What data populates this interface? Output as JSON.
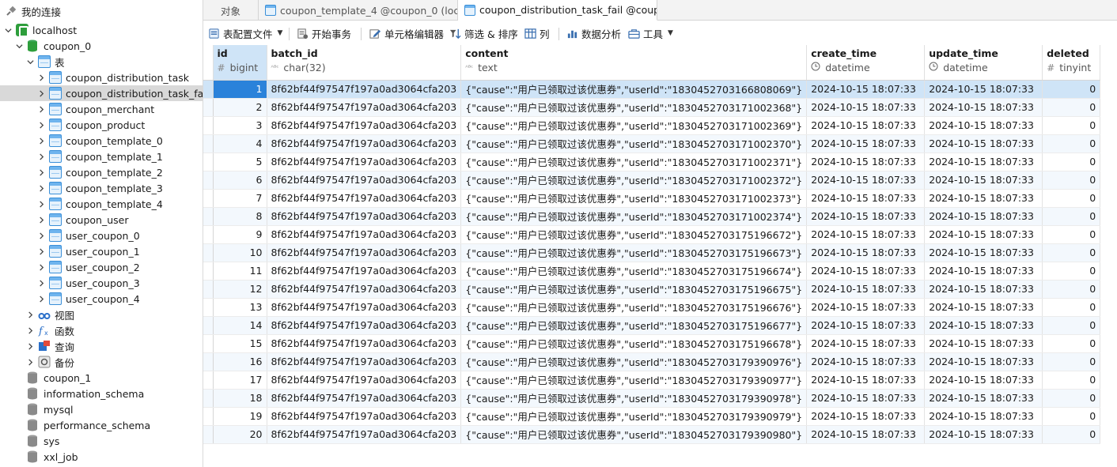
{
  "sidebar": {
    "root_label": "我的连接",
    "connection": "localhost",
    "database": "coupon_0",
    "tables_group": "表",
    "tables": [
      "coupon_distribution_task",
      "coupon_distribution_task_fail",
      "coupon_merchant",
      "coupon_product",
      "coupon_template_0",
      "coupon_template_1",
      "coupon_template_2",
      "coupon_template_3",
      "coupon_template_4",
      "coupon_user",
      "user_coupon_0",
      "user_coupon_1",
      "user_coupon_2",
      "user_coupon_3",
      "user_coupon_4"
    ],
    "selected_table": "coupon_distribution_task_fail",
    "groups": [
      "视图",
      "函数",
      "查询",
      "备份"
    ],
    "other_databases": [
      "coupon_1",
      "information_schema",
      "mysql",
      "performance_schema",
      "sys",
      "xxl_job"
    ]
  },
  "tabs": [
    {
      "label": "对象"
    },
    {
      "label": "coupon_template_4 @coupon_0 (loc..."
    },
    {
      "label": "coupon_distribution_task_fail @coup..."
    }
  ],
  "toolbar": {
    "table_config": "表配置文件",
    "begin_transaction": "开始事务",
    "cell_editor": "单元格编辑器",
    "filter_sort": "筛选 & 排序",
    "columns": "列",
    "data_analysis": "数据分析",
    "tools": "工具"
  },
  "grid": {
    "columns": [
      {
        "name": "id",
        "type": "bigint",
        "type_icon": "#"
      },
      {
        "name": "batch_id",
        "type": "char(32)",
        "type_icon": "ABC"
      },
      {
        "name": "content",
        "type": "text",
        "type_icon": "ABC"
      },
      {
        "name": "create_time",
        "type": "datetime",
        "type_icon": "clock"
      },
      {
        "name": "update_time",
        "type": "datetime",
        "type_icon": "clock"
      },
      {
        "name": "deleted",
        "type": "tinyint",
        "type_icon": "#"
      }
    ],
    "rows": [
      {
        "id": "1",
        "batch_id": "8f62bf44f97547f197a0ad3064cfa203",
        "content": "{\"cause\":\"用户已领取过该优惠券\",\"userId\":\"1830452703166808069\"}",
        "create_time": "2024-10-15 18:07:33",
        "update_time": "2024-10-15 18:07:33",
        "deleted": "0"
      },
      {
        "id": "2",
        "batch_id": "8f62bf44f97547f197a0ad3064cfa203",
        "content": "{\"cause\":\"用户已领取过该优惠券\",\"userId\":\"1830452703171002368\"}",
        "create_time": "2024-10-15 18:07:33",
        "update_time": "2024-10-15 18:07:33",
        "deleted": "0"
      },
      {
        "id": "3",
        "batch_id": "8f62bf44f97547f197a0ad3064cfa203",
        "content": "{\"cause\":\"用户已领取过该优惠券\",\"userId\":\"1830452703171002369\"}",
        "create_time": "2024-10-15 18:07:33",
        "update_time": "2024-10-15 18:07:33",
        "deleted": "0"
      },
      {
        "id": "4",
        "batch_id": "8f62bf44f97547f197a0ad3064cfa203",
        "content": "{\"cause\":\"用户已领取过该优惠券\",\"userId\":\"1830452703171002370\"}",
        "create_time": "2024-10-15 18:07:33",
        "update_time": "2024-10-15 18:07:33",
        "deleted": "0"
      },
      {
        "id": "5",
        "batch_id": "8f62bf44f97547f197a0ad3064cfa203",
        "content": "{\"cause\":\"用户已领取过该优惠券\",\"userId\":\"1830452703171002371\"}",
        "create_time": "2024-10-15 18:07:33",
        "update_time": "2024-10-15 18:07:33",
        "deleted": "0"
      },
      {
        "id": "6",
        "batch_id": "8f62bf44f97547f197a0ad3064cfa203",
        "content": "{\"cause\":\"用户已领取过该优惠券\",\"userId\":\"1830452703171002372\"}",
        "create_time": "2024-10-15 18:07:33",
        "update_time": "2024-10-15 18:07:33",
        "deleted": "0"
      },
      {
        "id": "7",
        "batch_id": "8f62bf44f97547f197a0ad3064cfa203",
        "content": "{\"cause\":\"用户已领取过该优惠券\",\"userId\":\"1830452703171002373\"}",
        "create_time": "2024-10-15 18:07:33",
        "update_time": "2024-10-15 18:07:33",
        "deleted": "0"
      },
      {
        "id": "8",
        "batch_id": "8f62bf44f97547f197a0ad3064cfa203",
        "content": "{\"cause\":\"用户已领取过该优惠券\",\"userId\":\"1830452703171002374\"}",
        "create_time": "2024-10-15 18:07:33",
        "update_time": "2024-10-15 18:07:33",
        "deleted": "0"
      },
      {
        "id": "9",
        "batch_id": "8f62bf44f97547f197a0ad3064cfa203",
        "content": "{\"cause\":\"用户已领取过该优惠券\",\"userId\":\"1830452703175196672\"}",
        "create_time": "2024-10-15 18:07:33",
        "update_time": "2024-10-15 18:07:33",
        "deleted": "0"
      },
      {
        "id": "10",
        "batch_id": "8f62bf44f97547f197a0ad3064cfa203",
        "content": "{\"cause\":\"用户已领取过该优惠券\",\"userId\":\"1830452703175196673\"}",
        "create_time": "2024-10-15 18:07:33",
        "update_time": "2024-10-15 18:07:33",
        "deleted": "0"
      },
      {
        "id": "11",
        "batch_id": "8f62bf44f97547f197a0ad3064cfa203",
        "content": "{\"cause\":\"用户已领取过该优惠券\",\"userId\":\"1830452703175196674\"}",
        "create_time": "2024-10-15 18:07:33",
        "update_time": "2024-10-15 18:07:33",
        "deleted": "0"
      },
      {
        "id": "12",
        "batch_id": "8f62bf44f97547f197a0ad3064cfa203",
        "content": "{\"cause\":\"用户已领取过该优惠券\",\"userId\":\"1830452703175196675\"}",
        "create_time": "2024-10-15 18:07:33",
        "update_time": "2024-10-15 18:07:33",
        "deleted": "0"
      },
      {
        "id": "13",
        "batch_id": "8f62bf44f97547f197a0ad3064cfa203",
        "content": "{\"cause\":\"用户已领取过该优惠券\",\"userId\":\"1830452703175196676\"}",
        "create_time": "2024-10-15 18:07:33",
        "update_time": "2024-10-15 18:07:33",
        "deleted": "0"
      },
      {
        "id": "14",
        "batch_id": "8f62bf44f97547f197a0ad3064cfa203",
        "content": "{\"cause\":\"用户已领取过该优惠券\",\"userId\":\"1830452703175196677\"}",
        "create_time": "2024-10-15 18:07:33",
        "update_time": "2024-10-15 18:07:33",
        "deleted": "0"
      },
      {
        "id": "15",
        "batch_id": "8f62bf44f97547f197a0ad3064cfa203",
        "content": "{\"cause\":\"用户已领取过该优惠券\",\"userId\":\"1830452703175196678\"}",
        "create_time": "2024-10-15 18:07:33",
        "update_time": "2024-10-15 18:07:33",
        "deleted": "0"
      },
      {
        "id": "16",
        "batch_id": "8f62bf44f97547f197a0ad3064cfa203",
        "content": "{\"cause\":\"用户已领取过该优惠券\",\"userId\":\"1830452703179390976\"}",
        "create_time": "2024-10-15 18:07:33",
        "update_time": "2024-10-15 18:07:33",
        "deleted": "0"
      },
      {
        "id": "17",
        "batch_id": "8f62bf44f97547f197a0ad3064cfa203",
        "content": "{\"cause\":\"用户已领取过该优惠券\",\"userId\":\"1830452703179390977\"}",
        "create_time": "2024-10-15 18:07:33",
        "update_time": "2024-10-15 18:07:33",
        "deleted": "0"
      },
      {
        "id": "18",
        "batch_id": "8f62bf44f97547f197a0ad3064cfa203",
        "content": "{\"cause\":\"用户已领取过该优惠券\",\"userId\":\"1830452703179390978\"}",
        "create_time": "2024-10-15 18:07:33",
        "update_time": "2024-10-15 18:07:33",
        "deleted": "0"
      },
      {
        "id": "19",
        "batch_id": "8f62bf44f97547f197a0ad3064cfa203",
        "content": "{\"cause\":\"用户已领取过该优惠券\",\"userId\":\"1830452703179390979\"}",
        "create_time": "2024-10-15 18:07:33",
        "update_time": "2024-10-15 18:07:33",
        "deleted": "0"
      },
      {
        "id": "20",
        "batch_id": "8f62bf44f97547f197a0ad3064cfa203",
        "content": "{\"cause\":\"用户已领取过该优惠券\",\"userId\":\"1830452703179390980\"}",
        "create_time": "2024-10-15 18:07:33",
        "update_time": "2024-10-15 18:07:33",
        "deleted": "0"
      }
    ],
    "selected_row": 1
  },
  "colors": {
    "selection": "#cfe4f7",
    "selected_cell": "#2a82da",
    "table_icon": "#3a8fd8",
    "server_icon": "#2e9e3c"
  }
}
